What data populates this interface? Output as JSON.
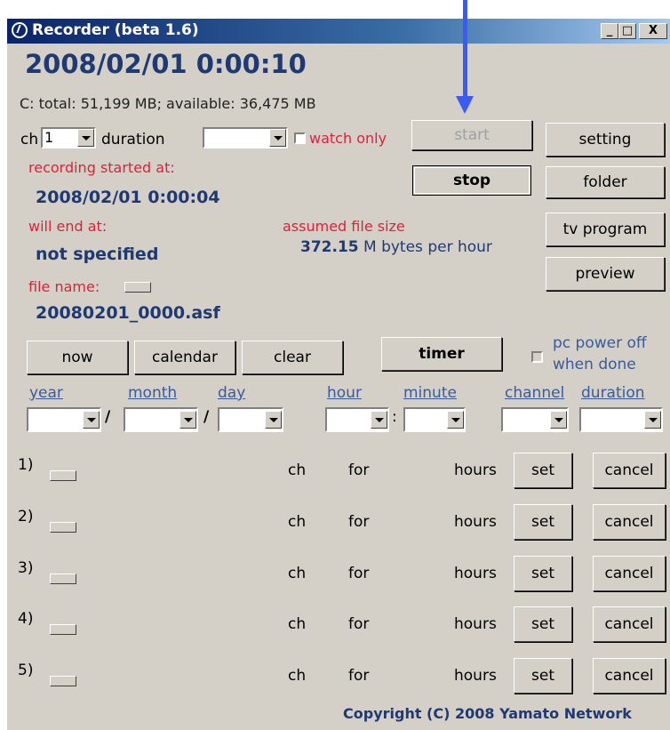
{
  "window": {
    "title": "Recorder (beta 1.6)",
    "minimize": "_",
    "maximize": "□",
    "close": "X"
  },
  "clock": "2008/02/01 0:00:10",
  "disk": "C:   total: 51,199 MB; available: 36,475 MB",
  "controls": {
    "ch_label": "ch",
    "ch_value": "1",
    "duration_label": "duration",
    "duration_value": "",
    "watch_only": "watch only",
    "start": "start",
    "stop": "stop",
    "setting": "setting",
    "folder": "folder",
    "tv_program": "tv program",
    "preview": "preview"
  },
  "status": {
    "rec_started_label": "recording started at:",
    "rec_started_value": "2008/02/01 0:00:04",
    "will_end_label": "will end at:",
    "will_end_value": "not specified",
    "assumed_size_label": "assumed file size",
    "assumed_size_value": "372.15",
    "assumed_size_unit": " M bytes per hour",
    "file_name_label": "file name:",
    "file_name_value": "20080201_0000.asf"
  },
  "timer": {
    "now": "now",
    "calendar": "calendar",
    "clear": "clear",
    "timer": "timer",
    "pc_power_off_1": "pc power off",
    "pc_power_off_2": "when done",
    "labels": {
      "year": "year",
      "month": "month",
      "day": "day",
      "hour": "hour",
      "minute": "minute",
      "channel": "channel",
      "duration": "duration"
    },
    "sep_slash": "/",
    "sep_colon": ":"
  },
  "schedule": {
    "rows": [
      {
        "num": "1)",
        "ch": "ch",
        "for": "for",
        "hours": "hours",
        "set": "set",
        "cancel": "cancel"
      },
      {
        "num": "2)",
        "ch": "ch",
        "for": "for",
        "hours": "hours",
        "set": "set",
        "cancel": "cancel"
      },
      {
        "num": "3)",
        "ch": "ch",
        "for": "for",
        "hours": "hours",
        "set": "set",
        "cancel": "cancel"
      },
      {
        "num": "4)",
        "ch": "ch",
        "for": "for",
        "hours": "hours",
        "set": "set",
        "cancel": "cancel"
      },
      {
        "num": "5)",
        "ch": "ch",
        "for": "for",
        "hours": "hours",
        "set": "set",
        "cancel": "cancel"
      }
    ]
  },
  "copyright": "Copyright (C) 2008 Yamato Network",
  "colors": {
    "title_start": "#0a246a",
    "face": "#d4d0c8",
    "navy_text": "#1f3a73",
    "red_text": "#e0203a",
    "annotation_arrow": "#3b5bf5"
  }
}
